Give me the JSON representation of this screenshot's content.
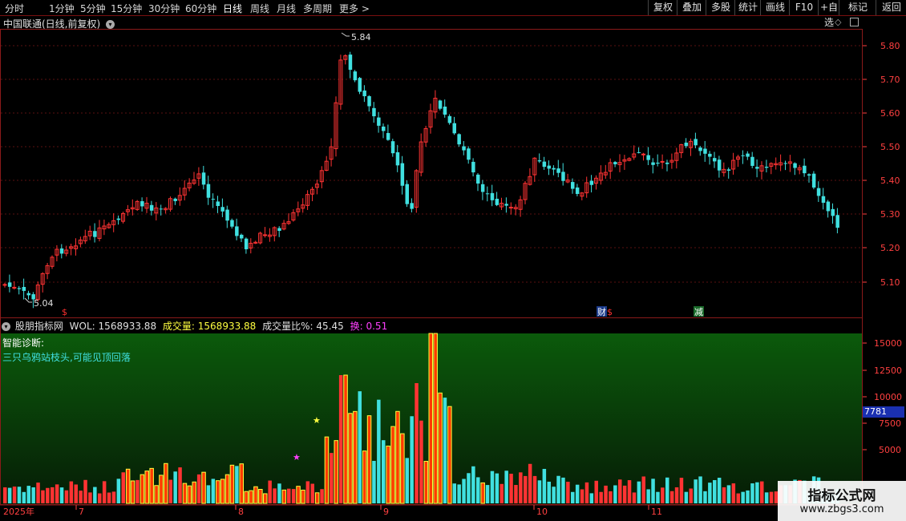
{
  "toolbar": {
    "periods": [
      "分时",
      "1分钟",
      "5分钟",
      "15分钟",
      "30分钟",
      "60分钟",
      "日线",
      "周线",
      "月线",
      "多周期",
      "更多 >"
    ],
    "right_buttons": [
      "复权",
      "叠加",
      "多股",
      "统计",
      "画线",
      "F10",
      "+自选",
      "标记",
      "返回"
    ]
  },
  "chart": {
    "title": "中国联通(日线,前复权)",
    "y_ticks": [
      "5.80",
      "5.70",
      "5.60",
      "5.50",
      "5.40",
      "5.30",
      "5.20",
      "5.10"
    ],
    "high_label": "5.84",
    "low_label": "5.04",
    "markers": [
      "$",
      "财",
      "$",
      "减"
    ]
  },
  "volume": {
    "indicator_name": "股朋指标网",
    "vol_label": "WOL:",
    "vol_value": "1568933.88",
    "cjl_label": "成交量:",
    "cjl_value": "1568933.88",
    "ratio_label": "成交量比%:",
    "ratio_value": "45.45",
    "turn_label": "换:",
    "turn_value": "0.51",
    "diag_title": "智能诊断:",
    "diag_text": "三只乌鸦站枝头,可能见顶回落",
    "y_ticks": [
      "15000",
      "12500",
      "10000",
      "7500",
      "5000"
    ],
    "current_label": "7781"
  },
  "x_axis": {
    "labels": [
      "2025年",
      "7",
      "8",
      "9",
      "10",
      "11"
    ]
  },
  "watermark": {
    "title": "指标公式网",
    "url": "www.zbgs3.com"
  },
  "colors": {
    "up": "#ff3333",
    "down": "#40e0e0",
    "yellow": "#ffff40",
    "border": "#8b1a1a",
    "volume_bg_top": "#0b5a0b"
  }
}
